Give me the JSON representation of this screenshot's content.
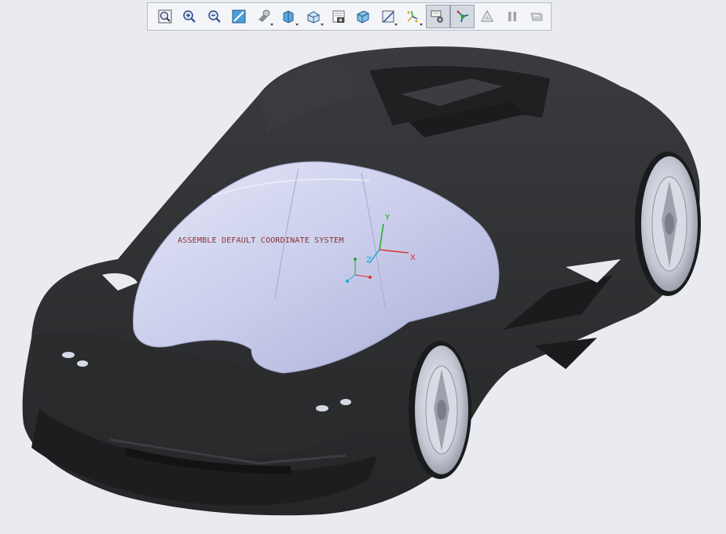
{
  "toolbar": {
    "buttons": [
      {
        "icon": "refit-icon",
        "dropdown": false,
        "active": false
      },
      {
        "icon": "zoom-in-icon",
        "dropdown": false,
        "active": false
      },
      {
        "icon": "zoom-out-icon",
        "dropdown": false,
        "active": false
      },
      {
        "icon": "repaint-icon",
        "dropdown": false,
        "active": false
      },
      {
        "icon": "render-style-icon",
        "dropdown": true,
        "active": false
      },
      {
        "icon": "display-style-icon",
        "dropdown": true,
        "active": false
      },
      {
        "icon": "saved-orientations-icon",
        "dropdown": true,
        "active": false
      },
      {
        "icon": "view-manager-icon",
        "dropdown": false,
        "active": false
      },
      {
        "icon": "perspective-icon",
        "dropdown": false,
        "active": false
      },
      {
        "icon": "section-icon",
        "dropdown": true,
        "active": false
      },
      {
        "icon": "datum-display-icon",
        "dropdown": true,
        "active": false
      },
      {
        "icon": "annotation-display-icon",
        "dropdown": false,
        "active": true
      },
      {
        "icon": "spin-center-icon",
        "dropdown": false,
        "active": true
      },
      {
        "icon": "simulation-icon",
        "dropdown": false,
        "active": false
      },
      {
        "icon": "pause-icon",
        "dropdown": false,
        "active": false
      },
      {
        "icon": "regenerate-icon",
        "dropdown": false,
        "active": false
      }
    ]
  },
  "viewport": {
    "datum_text": "ASSEMBLE DEFAULT COORDINATE SYSTEM",
    "axis_x": "X",
    "axis_y": "Y",
    "axis_z": "Z"
  },
  "colors": {
    "background": "#e9ebf0",
    "car_body": "#2e2f31",
    "canopy": "#c6cae8",
    "wheel": "#b9bcc6",
    "axis_x": "#d33",
    "axis_y": "#2a2",
    "axis_z": "#2ad"
  }
}
